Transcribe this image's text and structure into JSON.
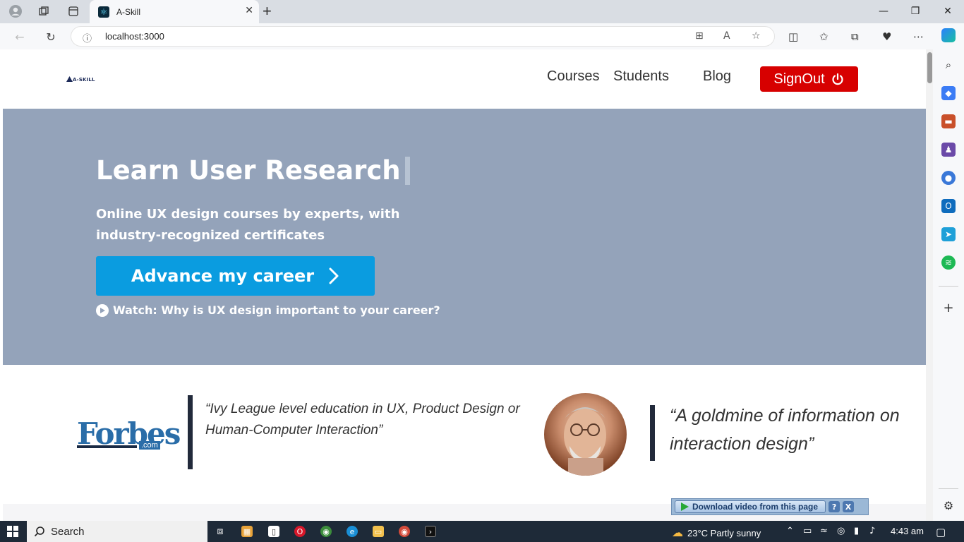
{
  "browser": {
    "tab_title": "A-Skill",
    "url": "localhost:3000"
  },
  "site": {
    "logo_text": "A-SKILL",
    "nav": {
      "courses": "Courses",
      "students": "Students",
      "blog": "Blog",
      "signout": "SignOut"
    },
    "hero": {
      "title": "Learn User Research",
      "subtitle": "Online UX design courses by experts, with industry-recognized certificates",
      "cta_label": "Advance my career",
      "watch_label": "Watch: Why is UX design important to your career?"
    },
    "press": {
      "forbes_logo": "Forbes",
      "forbes_com": ".com",
      "quote1": "“Ivy League level education in UX, Product Design or Human-Computer Interaction”",
      "quote2": "“A goldmine of information on interaction design”"
    }
  },
  "download_bar": {
    "label": "Download video from this page",
    "help": "?",
    "close": "X"
  },
  "taskbar": {
    "search_label": "Search",
    "weather": "23°C  Partly sunny",
    "time": "4:43 am"
  },
  "colors": {
    "hero_bg": "#94a3ba",
    "cta_blue": "#0a9ce0",
    "signout_red": "#d70000",
    "forbes_blue": "#2a6da8"
  }
}
